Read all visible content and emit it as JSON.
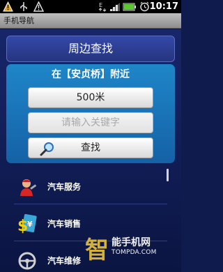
{
  "status_bar": {
    "time": "10:17",
    "icons": [
      "warning-icon",
      "usb-icon",
      "warning-icon",
      "signal-e-icon",
      "signal-bars-icon",
      "battery-icon",
      "alarm-icon"
    ]
  },
  "app": {
    "title": "手机导航"
  },
  "header": {
    "title": "周边查找"
  },
  "search": {
    "near_label": "在【安贞桥】附近",
    "distance": "500米",
    "keyword_placeholder": "请输入关键字",
    "search_label": "查找"
  },
  "list": {
    "items": [
      {
        "label": "汽车服务",
        "icon": "mechanic-icon"
      },
      {
        "label": "汽车销售",
        "icon": "money-icon"
      },
      {
        "label": "汽车维修",
        "icon": "steering-wheel-icon"
      }
    ]
  },
  "watermark": {
    "line1": "能手机网",
    "line2": "TOMPDA.COM"
  }
}
